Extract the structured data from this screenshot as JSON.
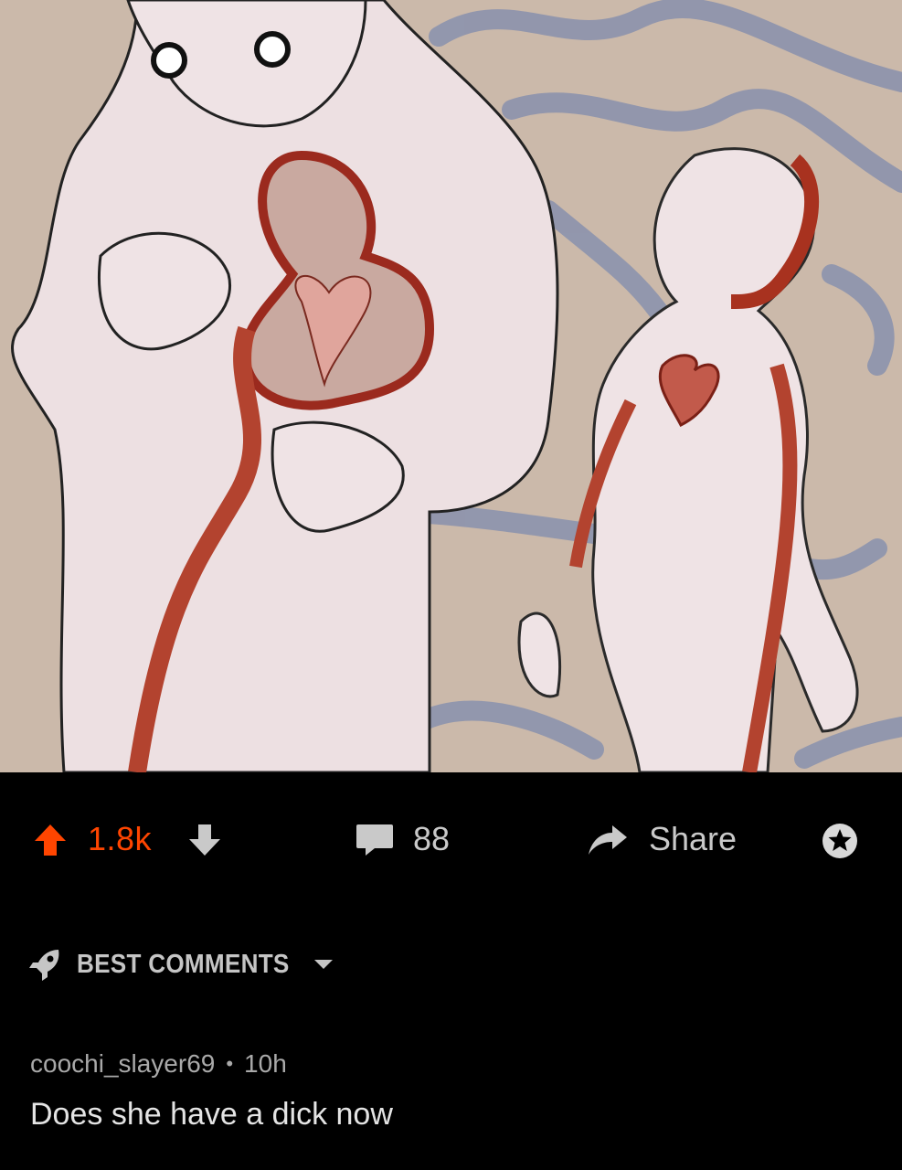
{
  "post": {
    "score": "1.8k",
    "comment_count": "88",
    "share_label": "Share"
  },
  "comments_section": {
    "sort_label": "BEST COMMENTS"
  },
  "comment": {
    "author": "coochi_slayer69",
    "separator": "•",
    "age": "10h",
    "text": "Does she have a dick now"
  },
  "colors": {
    "upvote_accent": "#ff4500",
    "background": "#000000",
    "muted_text": "#a9a9a9"
  },
  "icons": [
    "upvote-arrow-icon",
    "downvote-arrow-icon",
    "comment-bubble-icon",
    "share-arrow-icon",
    "award-icon",
    "rocket-icon",
    "caret-down-icon"
  ]
}
